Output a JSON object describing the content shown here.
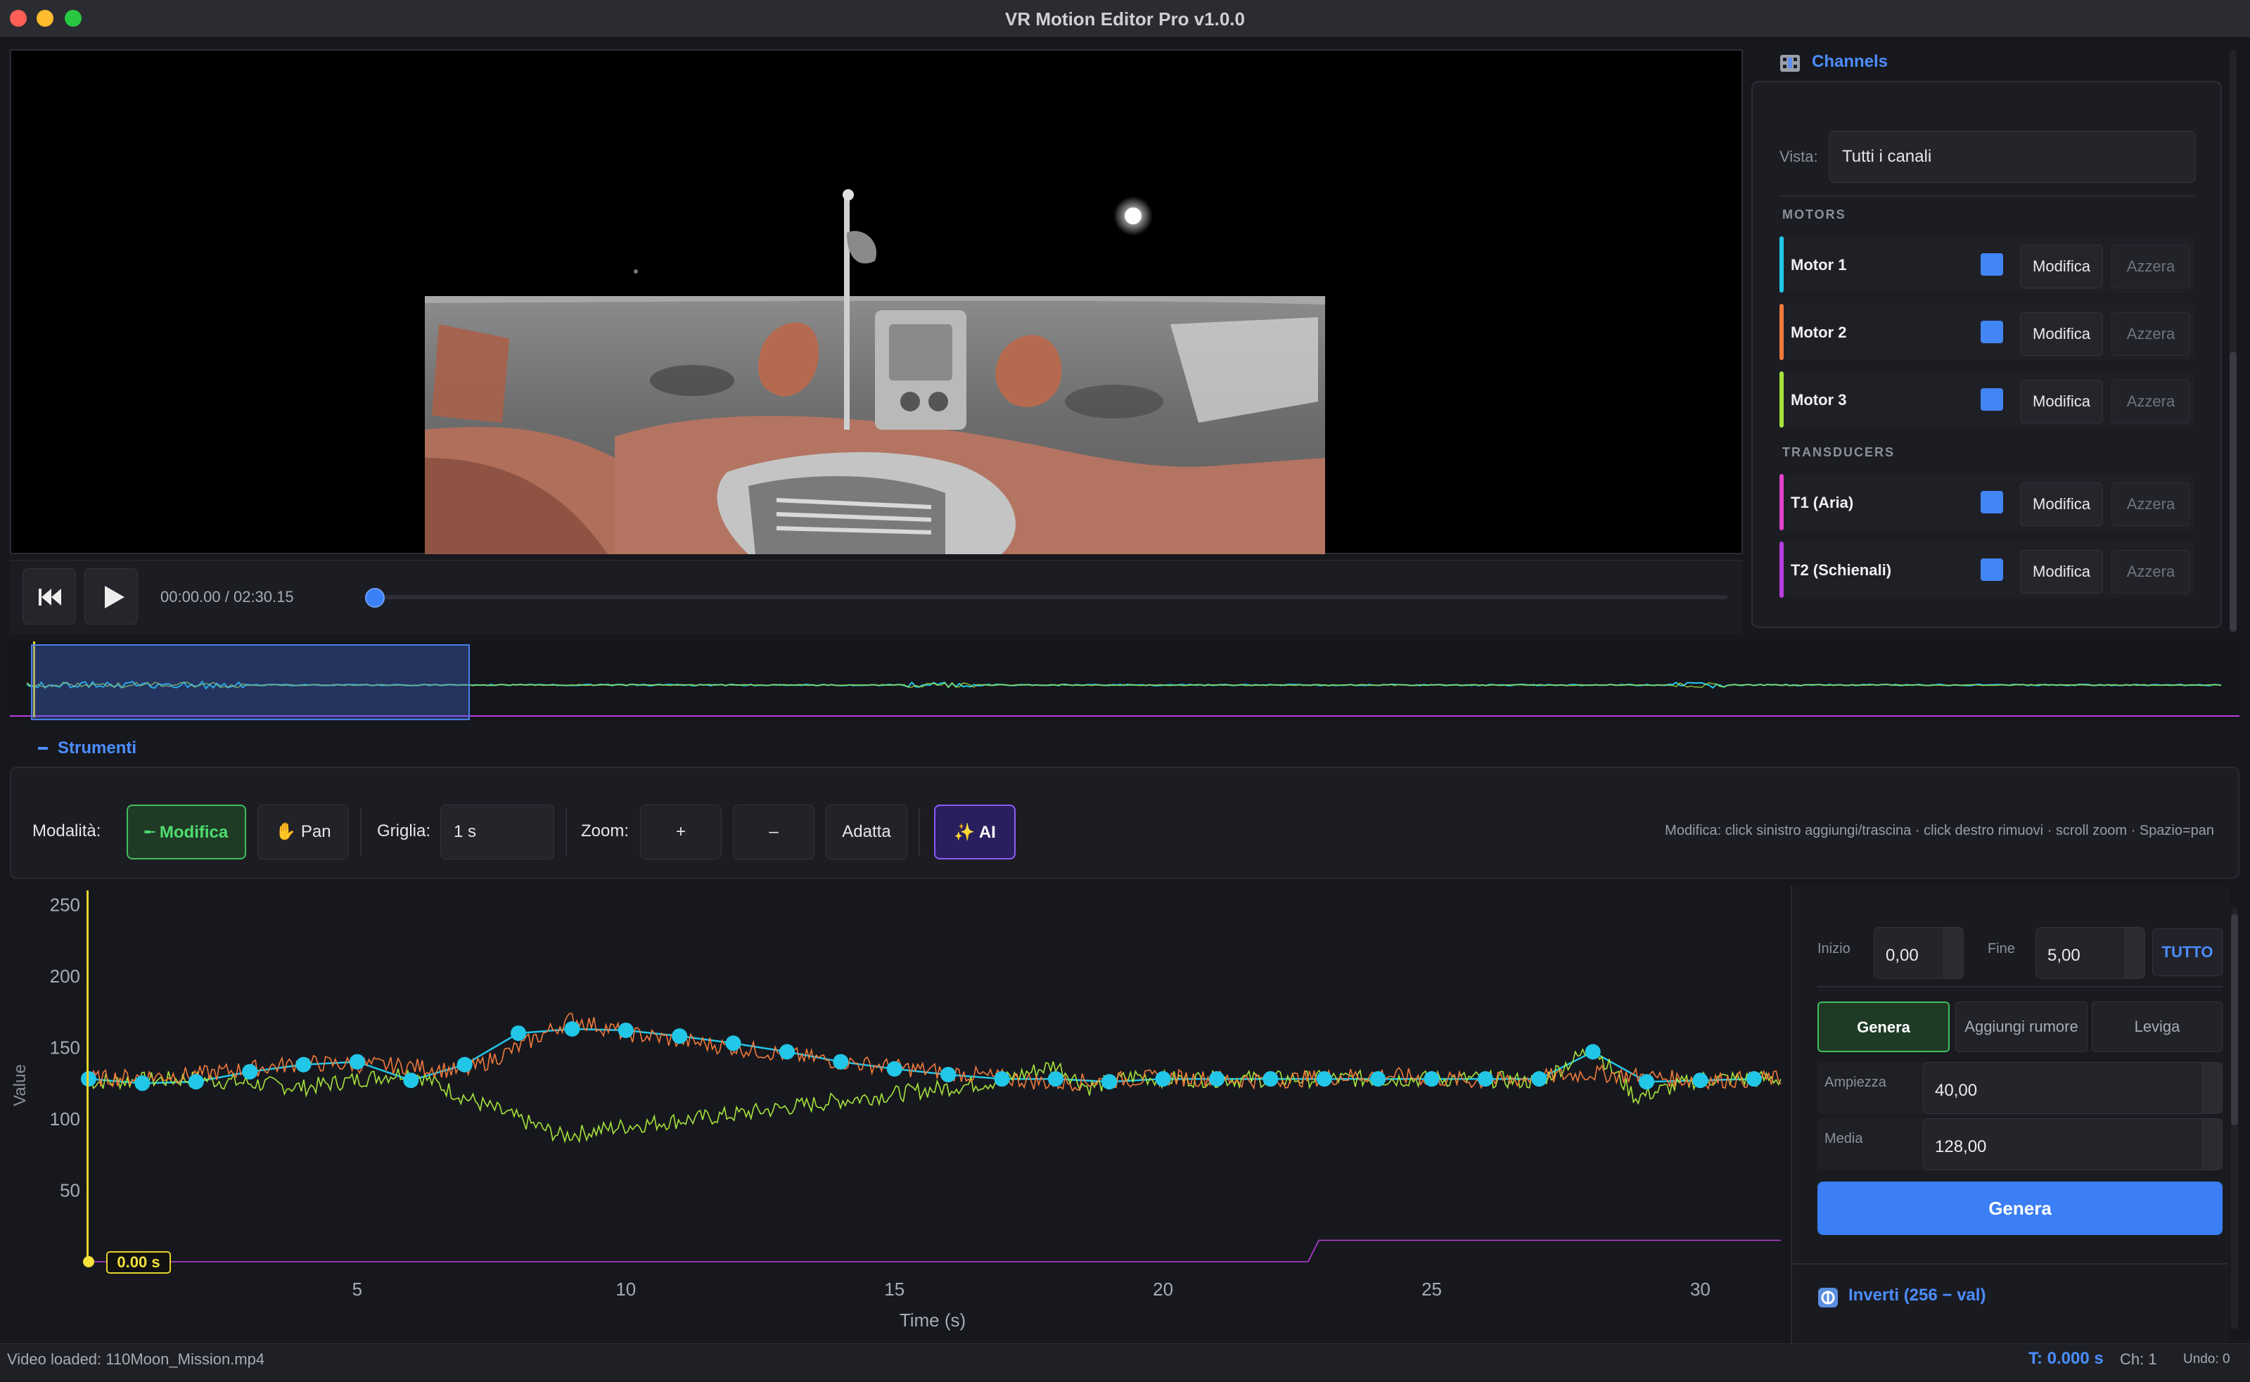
{
  "window": {
    "title": "VR Motion Editor Pro v1.0.0"
  },
  "player": {
    "time": "00:00.00 / 02:30.15"
  },
  "channels": {
    "header": "Channels",
    "vista_label": "Vista:",
    "vista_value": "Tutti i canali",
    "motors_label": "MOTORS",
    "transducers_label": "TRANSDUCERS",
    "modify_label": "Modifica",
    "reset_label": "Azzera",
    "items": [
      {
        "name": "Motor 1",
        "color": "#22c7e8"
      },
      {
        "name": "Motor 2",
        "color": "#f07a3c"
      },
      {
        "name": "Motor 3",
        "color": "#a6e33c"
      },
      {
        "name": "T1  (Aria)",
        "color": "#e442c9"
      },
      {
        "name": "T2  (Schienali)",
        "color": "#b63ee0"
      }
    ]
  },
  "tools": {
    "header": "Strumenti",
    "mode_label": "Modalità:",
    "edit_label": "Modifica",
    "pan_label": "Pan",
    "grid_label": "Griglia:",
    "grid_value": "1 s",
    "zoom_label": "Zoom:",
    "zoom_in": "+",
    "zoom_out": "–",
    "fit_label": "Adatta",
    "ai_label": "AI",
    "hint": "Modifica: click sinistro aggiungi/trascina · click destro rimuovi · scroll zoom · Spazio=pan"
  },
  "generator": {
    "start_label": "Inizio",
    "start_value": "0,00",
    "end_label": "Fine",
    "end_value": "5,00",
    "all_label": "TUTTO",
    "tab_generate": "Genera",
    "tab_noise": "Aggiungi rumore",
    "tab_smooth": "Leviga",
    "amplitude_label": "Ampiezza",
    "amplitude_value": "40,00",
    "mean_label": "Media",
    "mean_value": "128,00",
    "generate_button": "Genera",
    "invert_label": "Inverti  (256 − val)"
  },
  "status": {
    "left": "Video loaded: 110Moon_Mission.mp4",
    "time": "T: 0.000 s",
    "channel": "Ch: 1",
    "undo": "Undo: 0"
  },
  "chart_data": {
    "type": "line",
    "xlabel": "Time (s)",
    "ylabel": "Value",
    "xlim": [
      0,
      31.5
    ],
    "ylim": [
      0,
      260
    ],
    "xticks": [
      5,
      10,
      15,
      20,
      25,
      30
    ],
    "yticks": [
      50,
      100,
      150,
      200,
      250
    ],
    "playhead_label": "0.00 s",
    "series": [
      {
        "color": "#22c7e8",
        "x": [
          0,
          1,
          2,
          3,
          4,
          5,
          6,
          7,
          8,
          9,
          10,
          11,
          12,
          13,
          14,
          15,
          16,
          17,
          18,
          19,
          20,
          21,
          22,
          23,
          24,
          25,
          26,
          27,
          28,
          29,
          30,
          31
        ],
        "y": [
          128,
          125,
          126,
          133,
          138,
          140,
          127,
          138,
          160,
          163,
          162,
          158,
          153,
          147,
          140,
          135,
          131,
          128,
          128,
          126,
          128,
          128,
          128,
          128,
          128,
          128,
          128,
          128,
          147,
          126,
          127,
          128
        ]
      },
      {
        "color": "#a6e33c",
        "x": [
          0,
          2,
          4,
          6,
          7,
          8,
          8.8,
          10,
          12,
          14,
          16,
          17,
          18,
          18.6,
          19.5,
          20,
          22,
          24,
          26,
          27,
          28,
          28.8,
          30,
          31.5
        ],
        "y": [
          126,
          128,
          122,
          133,
          115,
          100,
          88,
          95,
          103,
          113,
          122,
          127,
          138,
          122,
          130,
          128,
          128,
          128,
          128,
          126,
          150,
          115,
          128,
          128
        ]
      },
      {
        "color": "#f07a3c",
        "x": [
          0,
          2,
          4,
          6,
          7,
          8,
          9,
          10,
          14,
          18,
          20,
          22,
          24,
          26,
          28,
          30,
          31.5
        ],
        "y": [
          128,
          131,
          139,
          137,
          133,
          150,
          170,
          160,
          140,
          125,
          129,
          127,
          131,
          126,
          132,
          127,
          128
        ]
      },
      {
        "color": "#b63ee0",
        "x": [
          0,
          22.7,
          22.9,
          31.5
        ],
        "y": [
          0,
          0,
          15,
          15
        ]
      }
    ]
  }
}
